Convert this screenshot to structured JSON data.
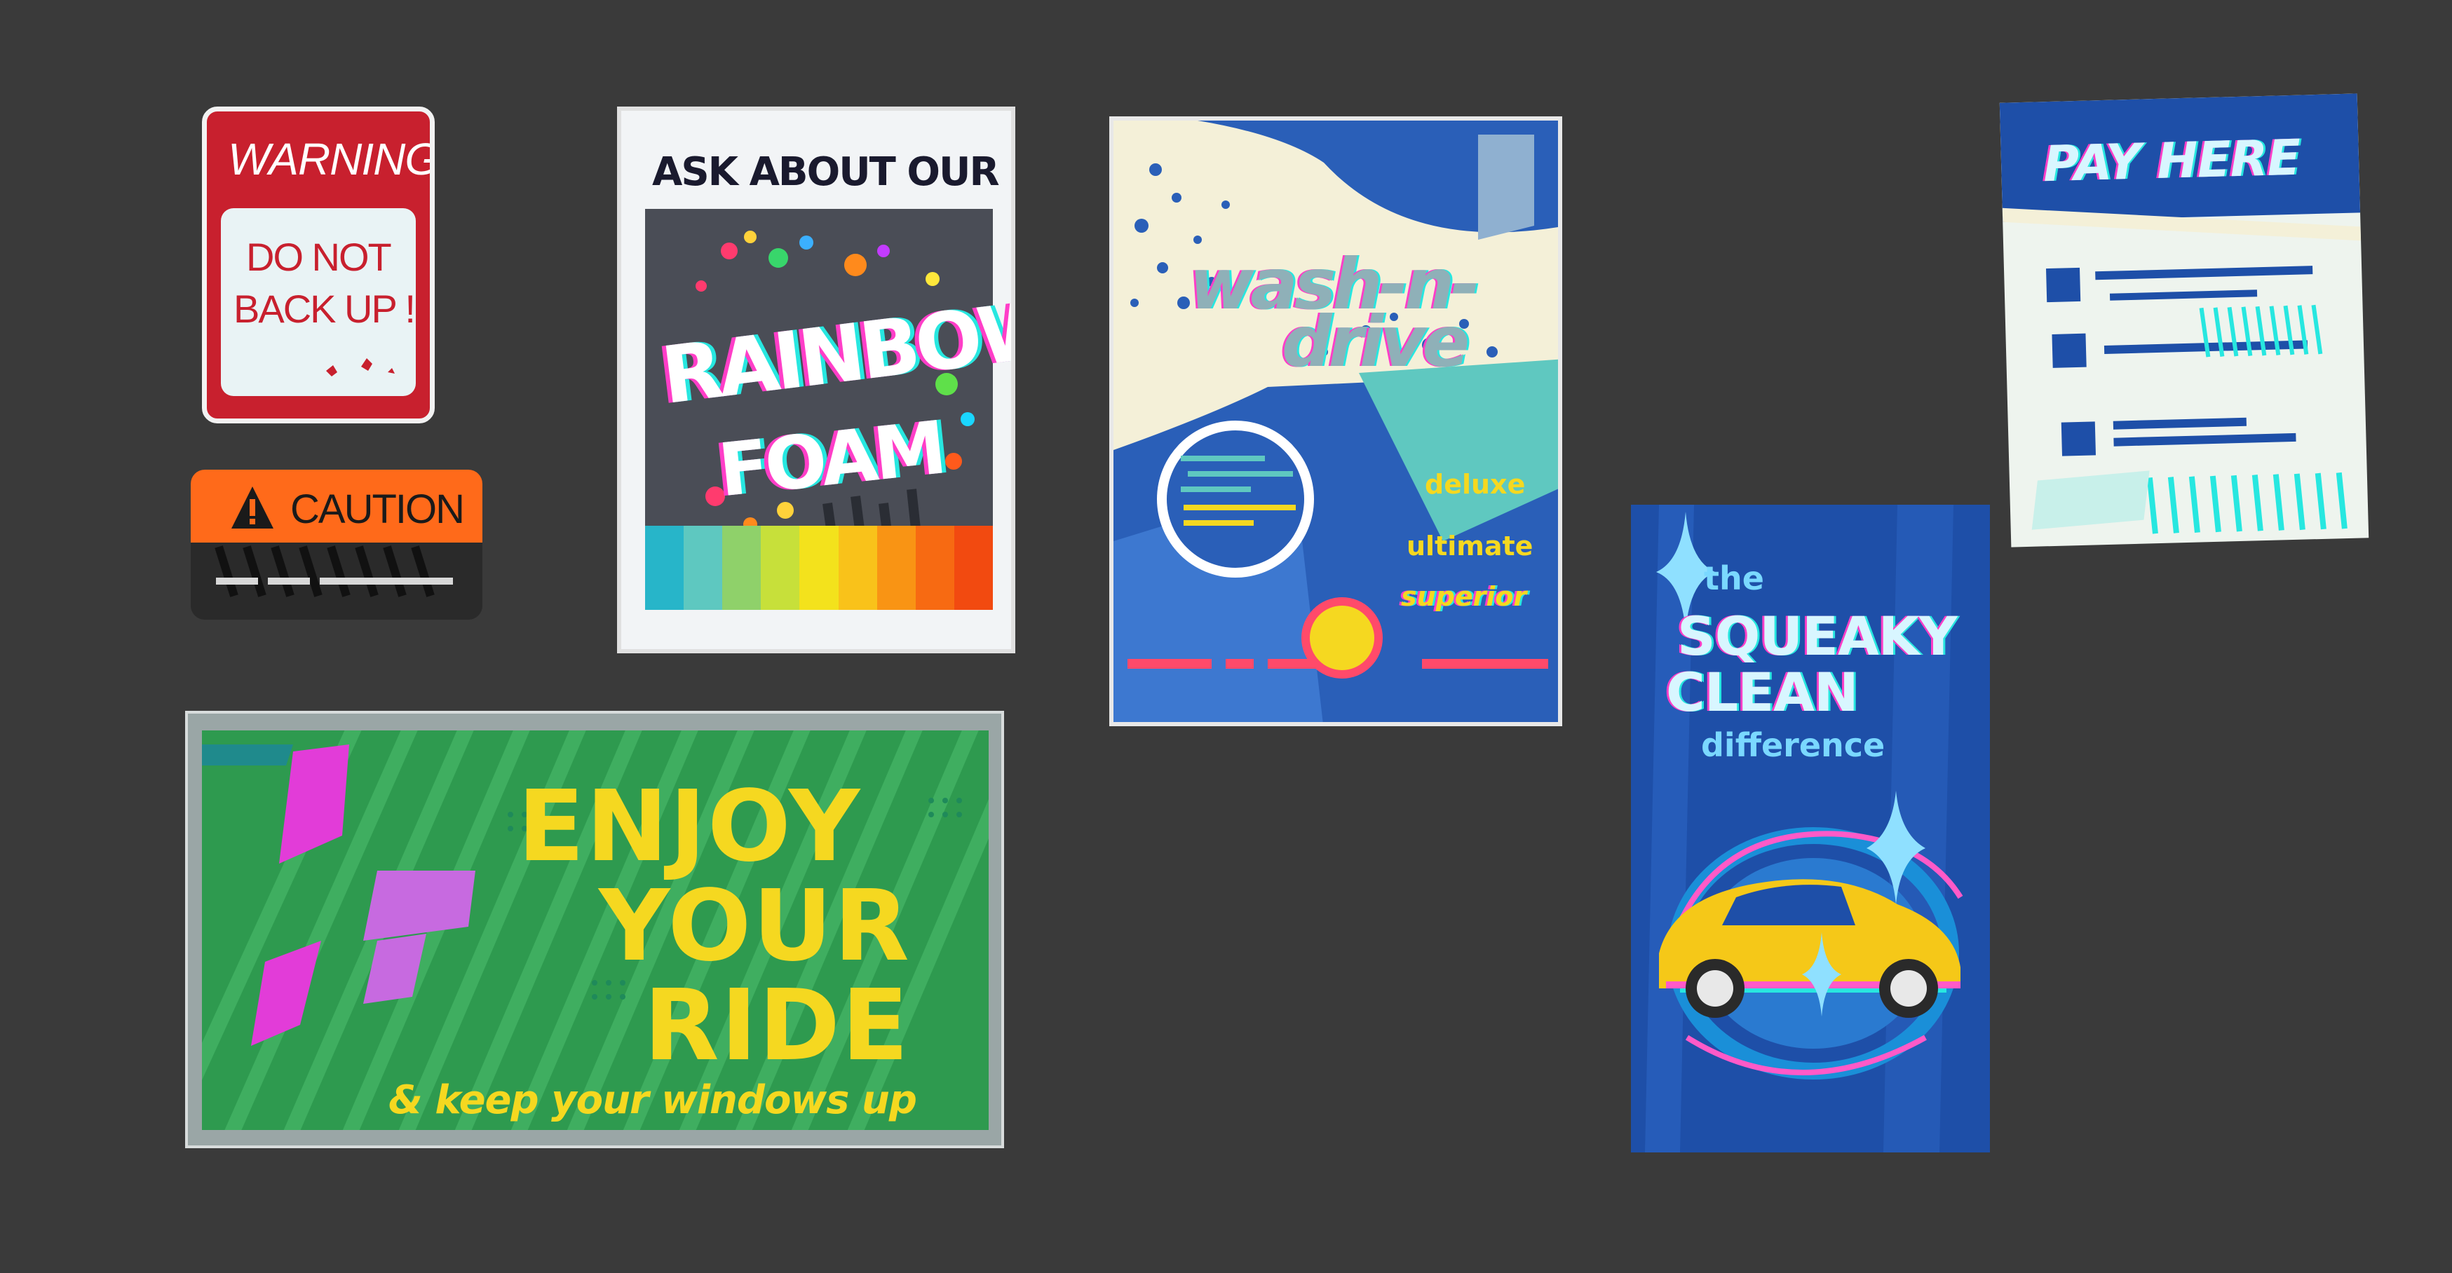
{
  "warning_sign": {
    "title": "WARNING",
    "line1": "DO NOT",
    "line2": "BACK UP !"
  },
  "caution_sign": {
    "label": "CAUTION",
    "icon": "warning-triangle-icon"
  },
  "rainbow_poster": {
    "header": "ASK ABOUT OUR",
    "line1": "RAINBOW",
    "line2": "FOAM",
    "swatches": [
      "#27b5c9",
      "#5ec8c0",
      "#8fd16a",
      "#c7e03a",
      "#f3e21c",
      "#f9c21a",
      "#f99414",
      "#f76a12",
      "#f24a10"
    ]
  },
  "wash_poster": {
    "line1": "wash-n-",
    "line2": "drive",
    "tiers": [
      "deluxe",
      "ultimate",
      "superior"
    ]
  },
  "billboard": {
    "line1": "ENJOY",
    "line2": "YOUR",
    "line3": "RIDE",
    "tagline": "& keep your windows up"
  },
  "squeaky_poster": {
    "line1": "the",
    "line2": "SQUEAKY",
    "line3": "CLEAN",
    "line4": "difference",
    "icon": "car-icon"
  },
  "pay_sign": {
    "title": "PAY HERE"
  },
  "colors": {
    "background": "#3a3a3a",
    "warning_red": "#c8202e",
    "caution_orange": "#ff6a1a",
    "billboard_green": "#2e9a4f",
    "billboard_yellow": "#f5d820",
    "poster_blue": "#2a5fb8",
    "cream": "#f4f0d8",
    "glitch_pink": "#ff3ec8",
    "glitch_cyan": "#27e7e0"
  }
}
